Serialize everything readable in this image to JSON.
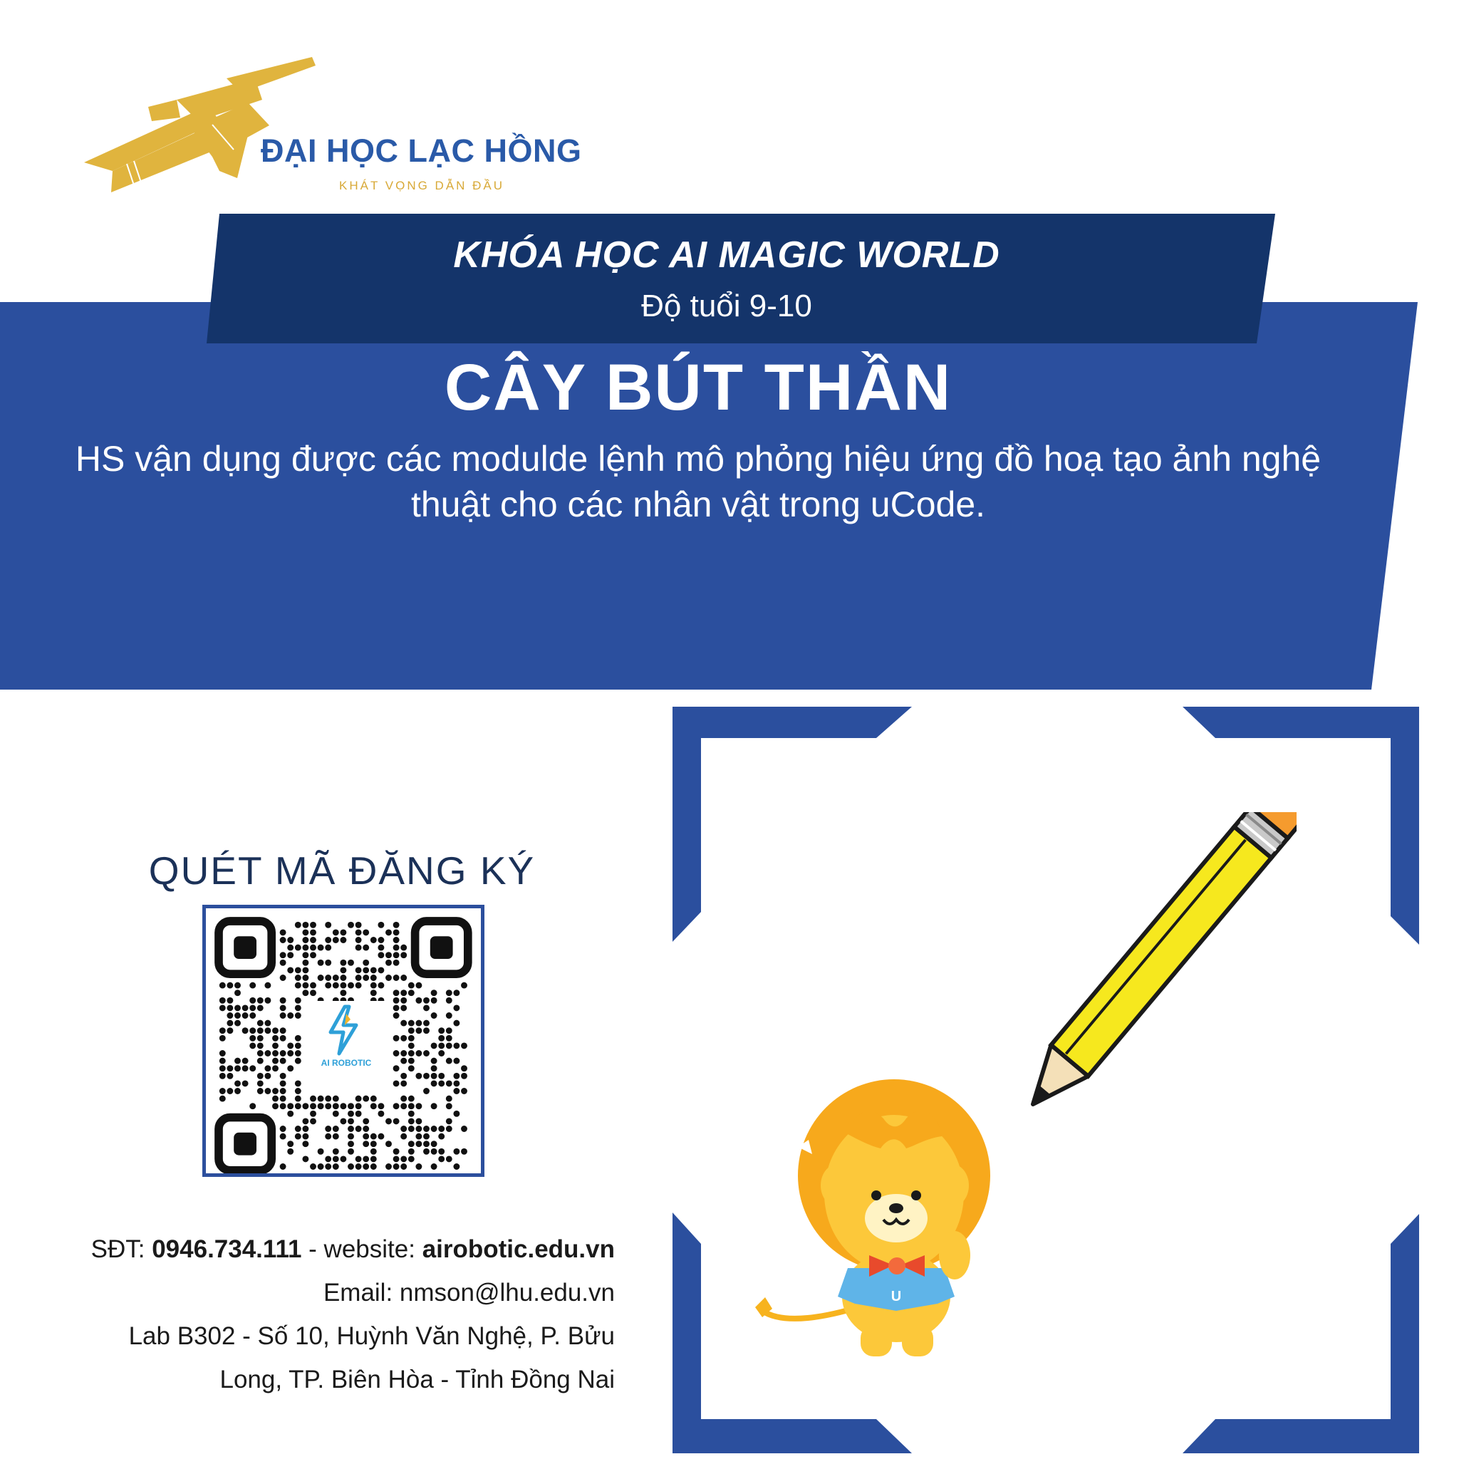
{
  "logo": {
    "name": "ĐẠI HỌC LẠC HỒNG",
    "slogan": "KHÁT VỌNG DẪN ĐẦU",
    "icon": "paper-plane-logo"
  },
  "course": {
    "title": "KHÓA HỌC AI MAGIC WORLD",
    "age": "Độ tuổi 9-10"
  },
  "lesson": {
    "title": "CÂY BÚT THẦN",
    "description": "HS vận dụng được các modulde lệnh mô phỏng hiệu ứng đồ hoạ tạo ảnh nghệ thuật cho các nhân vật trong uCode."
  },
  "qr": {
    "heading": "QUÉT MÃ ĐĂNG KÝ",
    "brand": "AI ROBOTIC"
  },
  "contact": {
    "phone_label": "SĐT: ",
    "phone": "0946.734.111",
    "website_label": " - website: ",
    "website": "airobotic.edu.vn",
    "email": "Email: nmson@lhu.edu.vn",
    "address_line1": "Lab B302 - Số 10, Huỳnh Văn Nghệ, P. Bửu",
    "address_line2": "Long, TP. Biên Hòa - Tỉnh Đồng Nai"
  },
  "colors": {
    "dark_navy": "#14346a",
    "panel_blue": "#2b4f9e",
    "gold": "#e0b43e",
    "logo_blue": "#2a5aa8"
  }
}
